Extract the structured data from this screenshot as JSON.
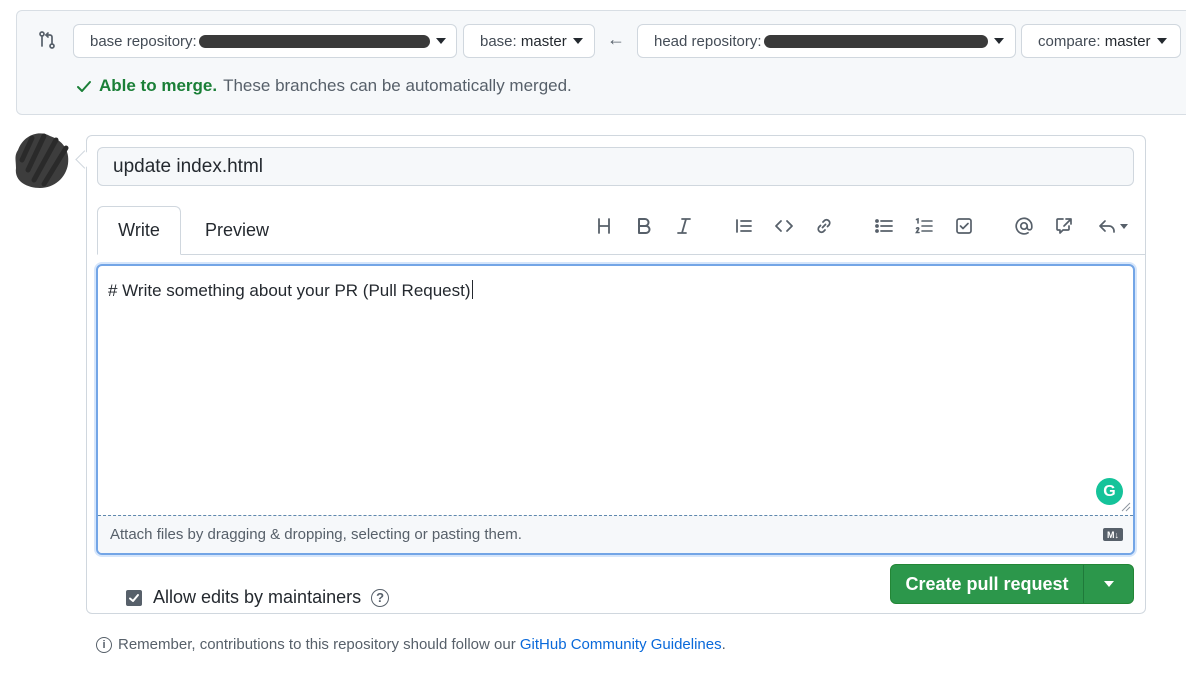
{
  "compare": {
    "base_repo_label": "base repository:",
    "base_branch_label": "base:",
    "base_branch_value": "master",
    "head_repo_label": "head repository:",
    "compare_label": "compare:",
    "compare_value": "master",
    "merge_status": "Able to merge.",
    "merge_detail": "These branches can be automatically merged."
  },
  "pr": {
    "title_value": "update index.html",
    "tab_write": "Write",
    "tab_preview": "Preview",
    "toolbar": [
      "heading-icon",
      "bold-icon",
      "italic-icon",
      "quote-icon",
      "code-icon",
      "link-icon",
      "unordered-list-icon",
      "ordered-list-icon",
      "task-list-icon",
      "mention-icon",
      "reference-icon",
      "reply-icon"
    ],
    "body_value": "# Write something about your PR (Pull Request)",
    "attach_hint": "Attach files by dragging & dropping, selecting or pasting them.",
    "markdown_badge": "M↓",
    "grammarly_letter": "G"
  },
  "footer": {
    "allow_edits_label": "Allow edits by maintainers",
    "allow_edits_checked": true,
    "help_glyph": "?",
    "create_button": "Create pull request",
    "remember_text": "Remember, contributions to this repository should follow our",
    "guidelines_link": "GitHub Community Guidelines",
    "remember_end": "."
  },
  "colors": {
    "accent_green": "#2c974b",
    "merge_green": "#1a7f37",
    "link_blue": "#0969da",
    "focus_blue": "#73a5e6"
  }
}
